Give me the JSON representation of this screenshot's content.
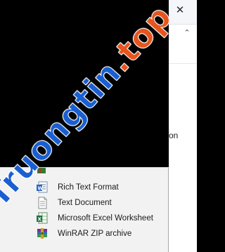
{
  "window": {
    "close_glyph": "✕",
    "toolbar_chevron_glyph": "⌃",
    "cut_text": "on"
  },
  "submenu": {
    "items": [
      {
        "label": "Rich Text Format",
        "icon": "wordpad-rtf-icon"
      },
      {
        "label": "Text Document",
        "icon": "text-document-icon"
      },
      {
        "label": "Microsoft Excel Worksheet",
        "icon": "excel-worksheet-icon"
      },
      {
        "label": "WinRAR ZIP archive",
        "icon": "winrar-zip-icon"
      }
    ]
  },
  "watermark": {
    "main": "Truongtin",
    "suffix": ".top"
  },
  "colors": {
    "background": "#000000",
    "menu_bg": "#f2f2f2",
    "watermark_blue": "#1a5fd1",
    "watermark_orange": "#e8541c"
  }
}
